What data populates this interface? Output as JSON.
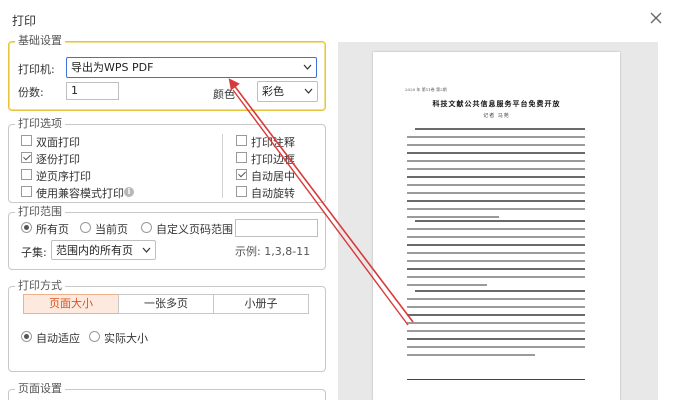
{
  "dialog": {
    "title": "打印",
    "close_icon": "close-icon"
  },
  "basic": {
    "legend": "基础设置",
    "printer_label": "打印机:",
    "printer_value": "导出为WPS PDF",
    "copies_label": "份数:",
    "copies_value": "1",
    "color_label": "颜色",
    "color_value": "彩色"
  },
  "options": {
    "legend": "打印选项",
    "left": [
      {
        "label": "双面打印",
        "checked": false
      },
      {
        "label": "逐份打印",
        "checked": true
      },
      {
        "label": "逆页序打印",
        "checked": false
      },
      {
        "label": "使用兼容模式打印",
        "checked": false
      }
    ],
    "right": [
      {
        "label": "打印注释",
        "checked": false
      },
      {
        "label": "打印边框",
        "checked": false
      },
      {
        "label": "自动居中",
        "checked": true
      },
      {
        "label": "自动旋转",
        "checked": false
      }
    ],
    "info_icon": "info-icon"
  },
  "range": {
    "legend": "打印范围",
    "radios": [
      {
        "label": "所有页",
        "checked": true
      },
      {
        "label": "当前页",
        "checked": false
      },
      {
        "label": "自定义页码范围",
        "checked": false
      }
    ],
    "custom_value": "",
    "subset_label": "子集:",
    "subset_value": "范围内的所有页",
    "example": "示例: 1,3,8-11"
  },
  "mode": {
    "legend": "打印方式",
    "segments": [
      "页面大小",
      "一张多页",
      "小册子"
    ],
    "selected_segment": "页面大小",
    "fit_radios": [
      {
        "label": "自动适应",
        "checked": true
      },
      {
        "label": "实际大小",
        "checked": false
      }
    ]
  },
  "page_setup": {
    "legend": "页面设置"
  },
  "preview": {
    "header": "2020 年 第11卷 第2期",
    "title": "科技文献公共信息服务平台免费开放",
    "author": "记者   马苑"
  },
  "colors": {
    "accent": "#d9541e",
    "arrow": "#d83a3a",
    "focus_border": "#e6c440"
  }
}
